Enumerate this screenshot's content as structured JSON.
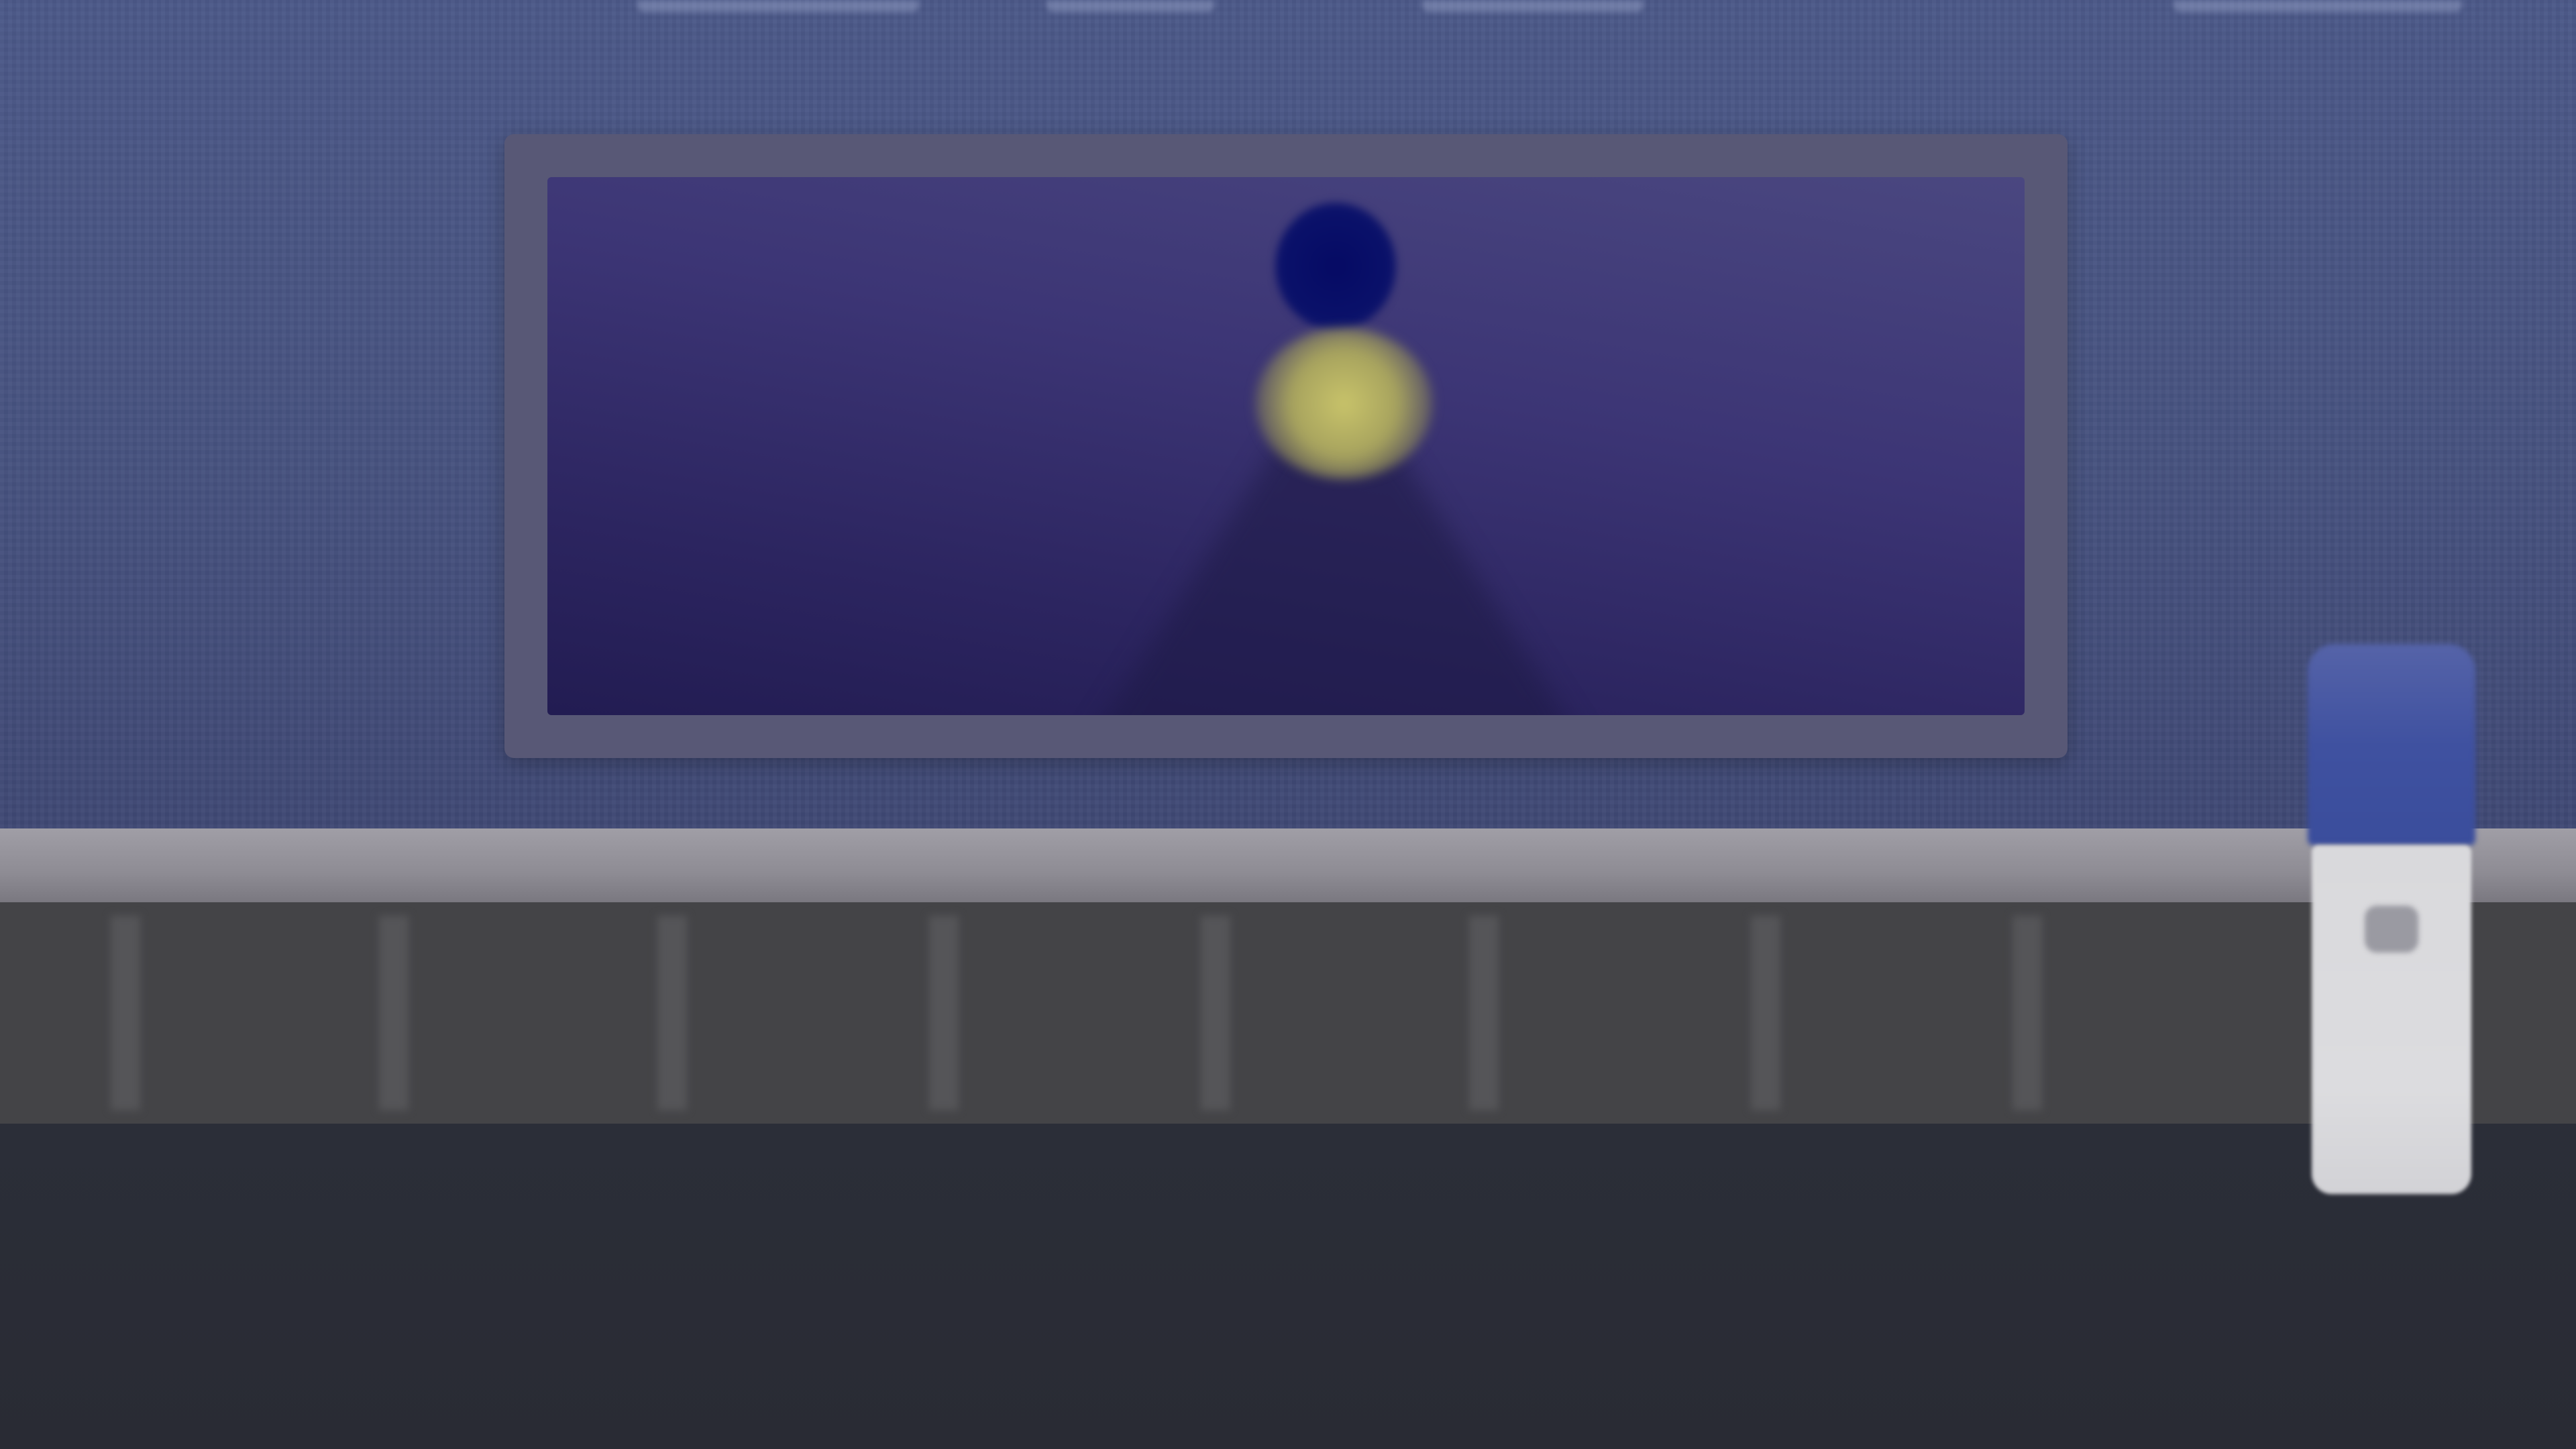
{
  "scene": {
    "colors": {
      "wall": "#46527f",
      "frame": "#585876",
      "canvas_sky": "#3c3575",
      "moon": "#0a116a",
      "lamp": "#b5b063",
      "ledge": "#8e8c94",
      "slats": "#444447",
      "floor": "#2a2d36",
      "device_blue": "#3f51a0",
      "device_white": "#dcdcdf"
    },
    "icons": {
      "moon": "moon-icon",
      "lamp": "lamp-icon",
      "device": "bottle-icon"
    }
  }
}
